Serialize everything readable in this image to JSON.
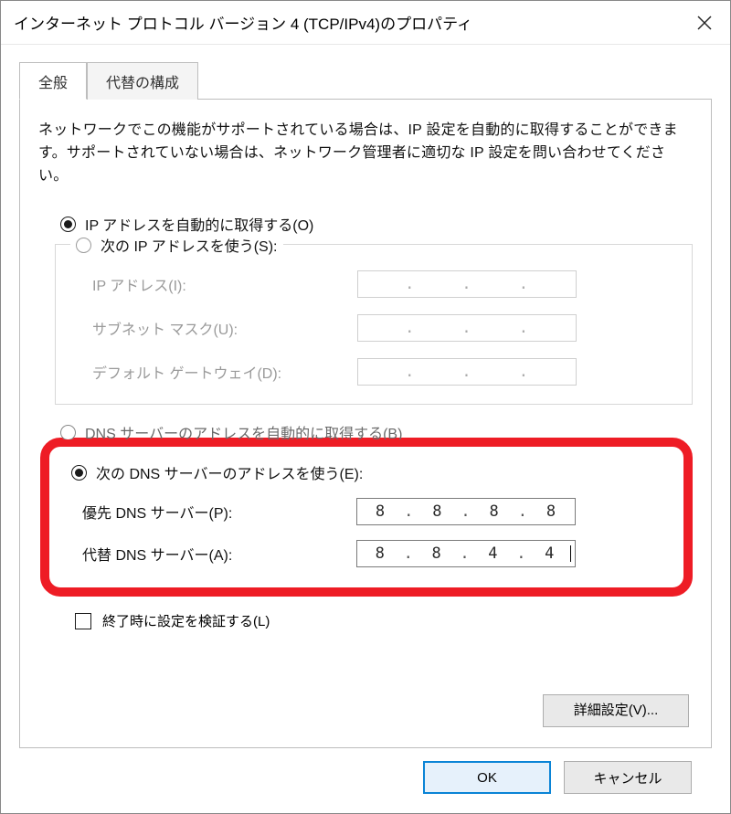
{
  "title": "インターネット プロトコル バージョン 4 (TCP/IPv4)のプロパティ",
  "tabs": {
    "general": "全般",
    "alternate": "代替の構成"
  },
  "intro": "ネットワークでこの機能がサポートされている場合は、IP 設定を自動的に取得することができます。サポートされていない場合は、ネットワーク管理者に適切な IP 設定を問い合わせてください。",
  "ip_auto_label": "IP アドレスを自動的に取得する(O)",
  "ip_manual_label": "次の IP アドレスを使う(S):",
  "ip_address_label": "IP アドレス(I):",
  "subnet_label": "サブネット マスク(U):",
  "gateway_label": "デフォルト ゲートウェイ(D):",
  "dns_auto_label": "DNS サーバーのアドレスを自動的に取得する(B)",
  "dns_manual_label": "次の DNS サーバーのアドレスを使う(E):",
  "pref_dns_label": "優先 DNS サーバー(P):",
  "alt_dns_label": "代替 DNS サーバー(A):",
  "pref_dns": {
    "o1": "8",
    "o2": "8",
    "o3": "8",
    "o4": "8"
  },
  "alt_dns": {
    "o1": "8",
    "o2": "8",
    "o3": "4",
    "o4": "4"
  },
  "validate_label": "終了時に設定を検証する(L)",
  "advanced_btn": "詳細設定(V)...",
  "ok_btn": "OK",
  "cancel_btn": "キャンセル"
}
